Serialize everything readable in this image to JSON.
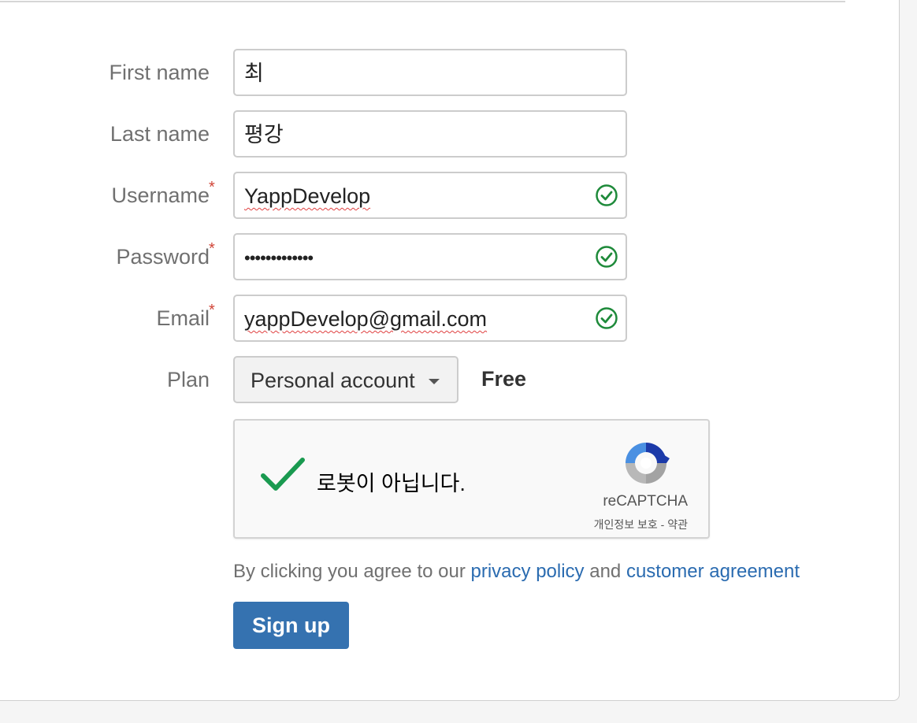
{
  "form": {
    "first_name": {
      "label": "First name",
      "value": "최"
    },
    "last_name": {
      "label": "Last name",
      "value": "평강"
    },
    "username": {
      "label": "Username",
      "value": "YappDevelop",
      "required_mark": "*"
    },
    "password": {
      "label": "Password",
      "value": "•••••••••••••",
      "required_mark": "*"
    },
    "email": {
      "label": "Email",
      "value": "yappDevelop@gmail.com",
      "required_mark": "*"
    },
    "plan": {
      "label": "Plan",
      "selected": "Personal account",
      "price": "Free"
    }
  },
  "recaptcha": {
    "status_text": "로봇이 아닙니다.",
    "brand": "reCAPTCHA",
    "privacy_link": "개인정보 보호",
    "separator": "-",
    "terms_link": "약관"
  },
  "agreement": {
    "prefix": "By clicking you agree to our",
    "privacy_link": "privacy policy",
    "conjunction": "and",
    "customer_link": "customer agreement"
  },
  "signup_button": "Sign up",
  "colors": {
    "valid_check": "#1e8a3a",
    "required": "#d04437",
    "link": "#2a6bb0",
    "primary_button": "#3572b0"
  }
}
